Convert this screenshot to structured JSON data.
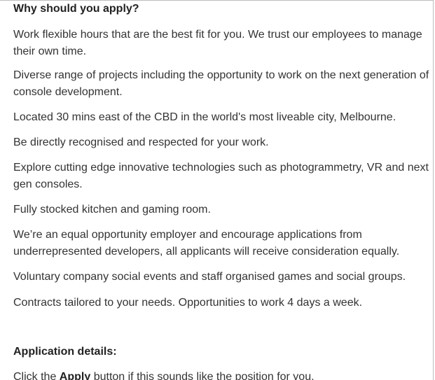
{
  "section1": {
    "heading": "Why should you apply?",
    "paragraphs": [
      "Work flexible hours that are the best fit for you. We trust our employees to manage their own time.",
      "Diverse range of projects including the opportunity to work on the next generation of console development.",
      "Located 30 mins east of the CBD in the world's most liveable city, Melbourne.",
      "Be directly recognised and respected for your work.",
      "Explore cutting edge innovative technologies such as photogrammetry, VR and next gen consoles.",
      "Fully stocked kitchen and gaming room.",
      "We’re an equal opportunity employer and encourage applications from underrepresented developers, all applicants will receive consideration equally.",
      "Voluntary company social events and staff organised games and social groups.",
      "Contracts tailored to your needs.  Opportunities to work 4 days a week."
    ]
  },
  "section2": {
    "heading": "Application details:",
    "apply_prefix": "Click the ",
    "apply_bold": "Apply",
    "apply_suffix": " button if this sounds like the position for you."
  }
}
